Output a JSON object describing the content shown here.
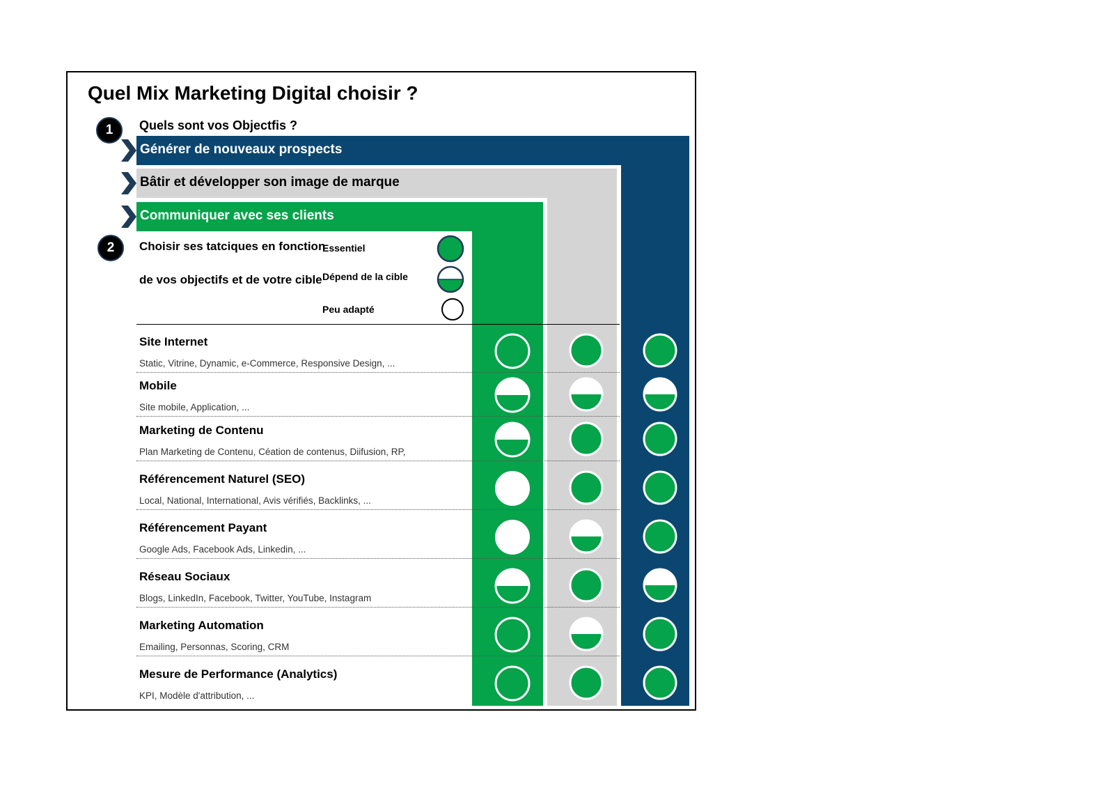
{
  "title": "Quel Mix Marketing Digital choisir ?",
  "step1": {
    "number": "1",
    "label": "Quels sont vos Objectfis ?"
  },
  "objectives": [
    {
      "label": "Générer de nouveaux prospects",
      "color": "#0b4670",
      "text_color": "#ffffff"
    },
    {
      "label": "Bâtir et développer son image de marque",
      "color": "#d4d4d4",
      "text_color": "#000000"
    },
    {
      "label": "Communiquer avec ses clients",
      "color": "#05a34a",
      "text_color": "#ffffff"
    }
  ],
  "step2": {
    "number": "2",
    "line1": "Choisir ses tatciques en fonction",
    "line2": "de vos objectifs et de votre cible"
  },
  "legend": [
    {
      "label": "Essentiel",
      "level": "full"
    },
    {
      "label": "Dépend de la cible",
      "level": "half"
    },
    {
      "label": "Peu adapté",
      "level": "empty"
    }
  ],
  "colors": {
    "green": "#05a34a",
    "navy": "#0b4670",
    "grey": "#d4d4d4",
    "chevron": "#1f3b57"
  },
  "tactics": [
    {
      "title": "Site Internet",
      "subtitle": "Static, Vitrine, Dynamic, e-Commerce, Responsive Design, ...",
      "ratings": [
        "full",
        "full",
        "full"
      ]
    },
    {
      "title": "Mobile",
      "subtitle": "Site mobile, Application, ...",
      "ratings": [
        "half",
        "half",
        "half"
      ]
    },
    {
      "title": "Marketing de Contenu",
      "subtitle": "Plan Marketing de Contenu, Céation de contenus, Diifusion, RP,",
      "ratings": [
        "half",
        "full",
        "full"
      ]
    },
    {
      "title": "Référencement Naturel (SEO)",
      "subtitle": "Local, National, International, Avis vérifiés, Backlinks, ...",
      "ratings": [
        "empty",
        "full",
        "full"
      ]
    },
    {
      "title": "Référencement Payant",
      "subtitle": "Google Ads, Facebook Ads, Linkedin, ...",
      "ratings": [
        "empty",
        "half",
        "full"
      ]
    },
    {
      "title": "Réseau Sociaux",
      "subtitle": "Blogs, LinkedIn, Facebook, Twitter, YouTube, Instagram",
      "ratings": [
        "half",
        "full",
        "half"
      ]
    },
    {
      "title": "Marketing Automation",
      "subtitle": "Emailing, Personnas, Scoring, CRM",
      "ratings": [
        "full",
        "half",
        "full"
      ]
    },
    {
      "title": "Mesure de Performance (Analytics)",
      "subtitle": "KPI, Modèle d'attribution, ...",
      "ratings": [
        "full",
        "full",
        "full"
      ]
    }
  ]
}
